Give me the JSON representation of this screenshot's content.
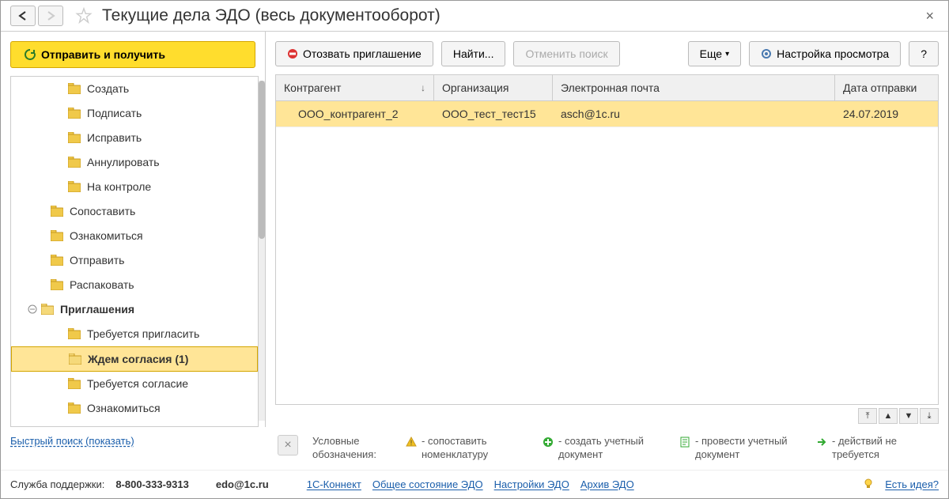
{
  "header": {
    "title": "Текущие дела ЭДО (весь документооборот)"
  },
  "sidebar": {
    "send_receive": "Отправить и получить",
    "tree": {
      "create": "Создать",
      "sign": "Подписать",
      "fix": "Исправить",
      "annul": "Аннулировать",
      "control": "На контроле",
      "match": "Сопоставить",
      "review1": "Ознакомиться",
      "send": "Отправить",
      "unpack": "Распаковать",
      "invitations": "Приглашения",
      "to_invite": "Требуется пригласить",
      "waiting": "Ждем согласия (1)",
      "need_consent": "Требуется согласие",
      "review2": "Ознакомиться"
    }
  },
  "toolbar": {
    "revoke": "Отозвать приглашение",
    "find": "Найти...",
    "cancel_search": "Отменить поиск",
    "more": "Еще",
    "view_settings": "Настройка просмотра",
    "help": "?"
  },
  "table": {
    "headers": {
      "contractor": "Контрагент",
      "organization": "Организация",
      "email": "Электронная почта",
      "date": "Дата отправки"
    },
    "rows": [
      {
        "contractor": "ООО_контрагент_2",
        "organization": "ООО_тест_тест15",
        "email": "asch@1c.ru",
        "date": "24.07.2019"
      }
    ]
  },
  "legend": {
    "label": "Условные обозначения:",
    "match": "- сопоставить номенклатуру",
    "create_doc": "- создать учетный документ",
    "post_doc": "- провести учетный документ",
    "no_action": "- действий не требуется"
  },
  "quick_search": "Быстрый поиск (показать)",
  "footer": {
    "support_label": "Служба поддержки:",
    "phone": "8-800-333-9313",
    "email": "edo@1c.ru",
    "connect": "1С-Коннект",
    "status": "Общее состояние ЭДО",
    "settings": "Настройки ЭДО",
    "archive": "Архив ЭДО",
    "idea": "Есть идея?"
  }
}
